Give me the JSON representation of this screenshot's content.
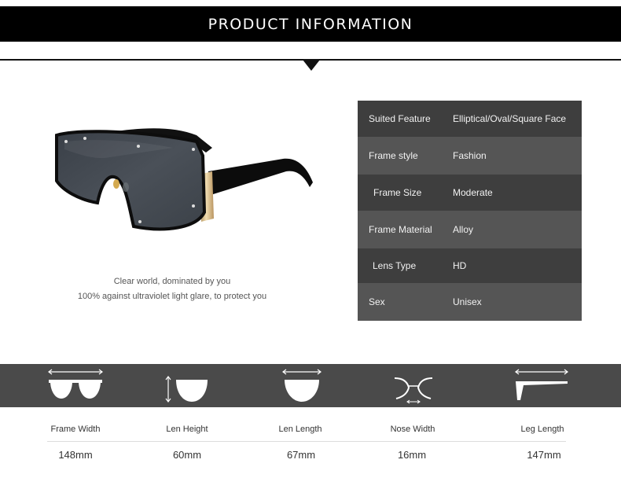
{
  "header": {
    "title": "PRODUCT INFORMATION"
  },
  "caption": {
    "line1": "Clear world, dominated by you",
    "line2": "100% against ultraviolet light glare, to protect you"
  },
  "specs": [
    {
      "label": "Suited Feature",
      "value": "Elliptical/Oval/Square Face",
      "bg": "#3e3e3e"
    },
    {
      "label": "Frame style",
      "value": "Fashion",
      "bg": "#555555"
    },
    {
      "label": "Frame Size",
      "value": "Moderate",
      "bg": "#3e3e3e"
    },
    {
      "label": "Frame Material",
      "value": "Alloy",
      "bg": "#555555"
    },
    {
      "label": "Lens Type",
      "value": "HD",
      "bg": "#3e3e3e"
    },
    {
      "label": "Sex",
      "value": "Unisex",
      "bg": "#555555"
    }
  ],
  "dimensions": [
    {
      "label": "Frame Width",
      "value": "148mm",
      "icon": "frame-width-icon"
    },
    {
      "label": "Len Height",
      "value": "60mm",
      "icon": "lens-height-icon"
    },
    {
      "label": "Len Length",
      "value": "67mm",
      "icon": "lens-length-icon"
    },
    {
      "label": "Nose Width",
      "value": "16mm",
      "icon": "nose-width-icon"
    },
    {
      "label": "Leg Length",
      "value": "147mm",
      "icon": "leg-length-icon"
    }
  ],
  "colors": {
    "header": "#000000",
    "table_dark": "#3e3e3e",
    "table_light": "#555555",
    "dim_bar": "#4a4a4a",
    "frame_gold": "#c8a46a"
  }
}
